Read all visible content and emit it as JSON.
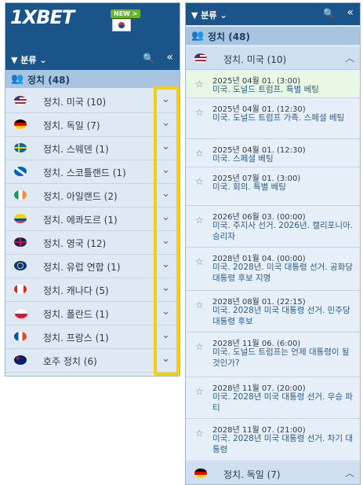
{
  "left": {
    "logo": "1XBET",
    "new_badge": "NEW >",
    "filter_label": "분류",
    "section_title": "정치 (48)",
    "countries": [
      {
        "name": "정치. 미국 (10)"
      },
      {
        "name": "정치. 독일 (7)"
      },
      {
        "name": "정치. 스웨덴 (1)"
      },
      {
        "name": "정치. 스코틀랜드 (1)"
      },
      {
        "name": "정치. 아일랜드 (2)"
      },
      {
        "name": "정치. 에콰도르 (1)"
      },
      {
        "name": "정치. 영국 (12)"
      },
      {
        "name": "정치. 유럽 연합 (1)"
      },
      {
        "name": "정치. 캐나다 (5)"
      },
      {
        "name": "정치. 폴란드 (1)"
      },
      {
        "name": "정치. 프랑스 (1)"
      },
      {
        "name": "호주 정치 (6)"
      }
    ]
  },
  "right": {
    "filter_label": "분류",
    "section_title": "정치 (48)",
    "open_country": "정치. 미국 (10)",
    "events": [
      {
        "date": "2025년 04월 01. (3:00)",
        "title": "미국. 도널드 트럼프. 특별 베팅"
      },
      {
        "date": "2025년 04월 01. (12:30)",
        "title": "미국. 도널드 트럼프 가족. 스페셜 베팅"
      },
      {
        "date": "2025년 04월 01. (12:30)",
        "title": "미국. 스페셜 베팅"
      },
      {
        "date": "2025년 07월 01. (3:00)",
        "title": "미국. 회의. 특별 베팅"
      },
      {
        "date": "2026년 06월 03. (00:00)",
        "title": "미국. 주지사 선거. 2026년. 캘리포니아. 승리자"
      },
      {
        "date": "2028년 01월 04. (00:00)",
        "title": "미국. 2028년. 미국 대통령 선거. 공화당 대통령 후보 지명"
      },
      {
        "date": "2028년 08월 01. (22:15)",
        "title": "미국. 2028년 미국 대통령 선거. 민주당 대통령 후보"
      },
      {
        "date": "2028년 11월 06. (6:00)",
        "title": "미국. 도널드 트럼프는 언제 대통령이 될 것인가?"
      },
      {
        "date": "2028년 11월 07. (20:00)",
        "title": "미국. 2028년 미국 대통령 선거. 우승 파티"
      },
      {
        "date": "2028년 11월 07. (21:00)",
        "title": "미국. 2028년 미국 대통령 선거. 차기 대통령"
      }
    ],
    "next_country": "정치. 독일 (7)"
  }
}
